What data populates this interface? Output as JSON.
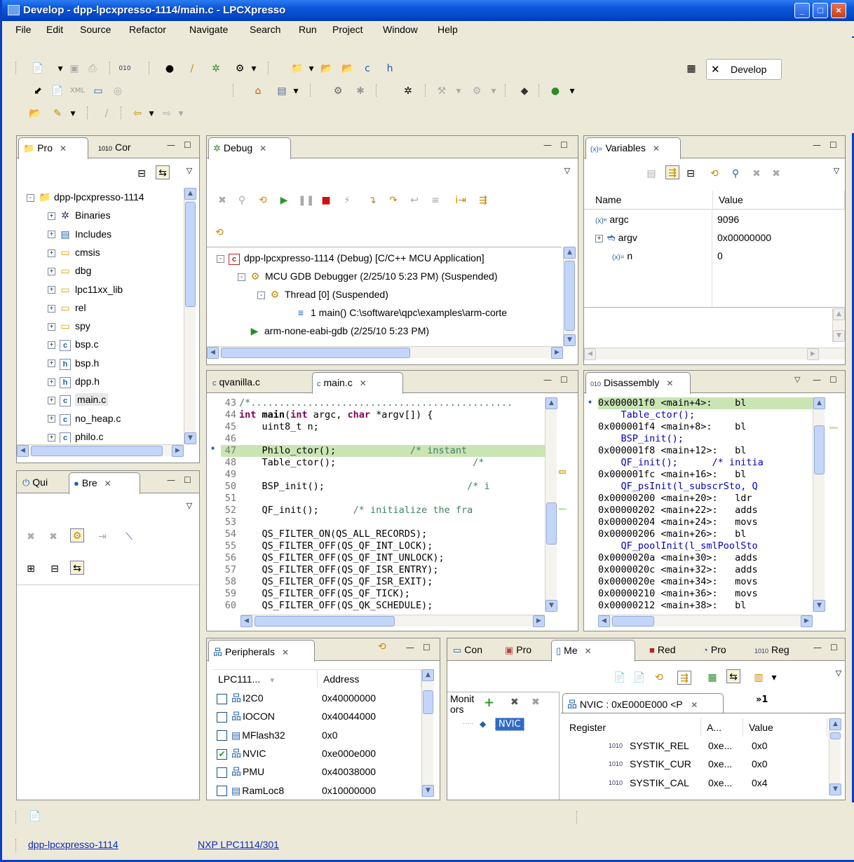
{
  "window": {
    "title": "Develop - dpp-lpcxpresso-1114/main.c - LPCXpresso"
  },
  "menu": [
    "File",
    "Edit",
    "Source",
    "Refactor",
    "Navigate",
    "Search",
    "Run",
    "Project",
    "Window",
    "Help"
  ],
  "perspective": {
    "label": "Develop"
  },
  "project_explorer": {
    "tabs": [
      "Pro",
      "Cor"
    ],
    "items": [
      {
        "label": "dpp-lpcxpresso-1114",
        "icon": "project-icon",
        "level": 0,
        "expand": "-"
      },
      {
        "label": "Binaries",
        "icon": "binaries-icon",
        "level": 1,
        "expand": "+"
      },
      {
        "label": "Includes",
        "icon": "includes-icon",
        "level": 1,
        "expand": "+"
      },
      {
        "label": "cmsis",
        "icon": "folder-icon",
        "level": 1,
        "expand": "+"
      },
      {
        "label": "dbg",
        "icon": "folder-icon",
        "level": 1,
        "expand": "+"
      },
      {
        "label": "lpc11xx_lib",
        "icon": "folder-icon",
        "level": 1,
        "expand": "+"
      },
      {
        "label": "rel",
        "icon": "folder-icon",
        "level": 1,
        "expand": "+"
      },
      {
        "label": "spy",
        "icon": "folder-icon",
        "level": 1,
        "expand": "+"
      },
      {
        "label": "bsp.c",
        "icon": "c-file-icon",
        "level": 1,
        "expand": "+"
      },
      {
        "label": "bsp.h",
        "icon": "h-file-icon",
        "level": 1,
        "expand": "+"
      },
      {
        "label": "dpp.h",
        "icon": "h-file-icon",
        "level": 1,
        "expand": "+"
      },
      {
        "label": "main.c",
        "icon": "c-file-icon",
        "level": 1,
        "expand": "+",
        "selected": true
      },
      {
        "label": "no_heap.c",
        "icon": "c-file-icon",
        "level": 1,
        "expand": "+"
      },
      {
        "label": "philo.c",
        "icon": "c-file-icon",
        "level": 1,
        "expand": "+"
      }
    ]
  },
  "breakpoints": {
    "tabs": [
      "Qui",
      "Bre"
    ]
  },
  "debug": {
    "tab": "Debug",
    "items": [
      {
        "label": "dpp-lpcxpresso-1114 (Debug) [C/C++ MCU Application]",
        "level": 0
      },
      {
        "label": "MCU GDB Debugger (2/25/10 5:23 PM) (Suspended)",
        "level": 1
      },
      {
        "label": "Thread [0] (Suspended)",
        "level": 2
      },
      {
        "label": "1 main() C:\\software\\qpc\\examples\\arm-corte",
        "level": 3
      },
      {
        "label": "arm-none-eabi-gdb (2/25/10 5:23 PM)",
        "level": 1
      }
    ]
  },
  "variables": {
    "tab": "Variables",
    "columns": [
      "Name",
      "Value"
    ],
    "rows": [
      {
        "name": "argc",
        "value": "9096"
      },
      {
        "name": "argv",
        "value": "0x00000000"
      },
      {
        "name": "n",
        "value": "0"
      }
    ]
  },
  "editor": {
    "tabs": [
      "qvanilla.c",
      "main.c"
    ],
    "lines": [
      {
        "n": "43",
        "t": "/*.............................................."
      },
      {
        "n": "44",
        "t": "int main(int argc, char *argv[]) {"
      },
      {
        "n": "45",
        "t": "    uint8_t n;"
      },
      {
        "n": "46",
        "t": ""
      },
      {
        "n": "47",
        "t": "    Philo_ctor();             /* instant"
      },
      {
        "n": "48",
        "t": "    Table_ctor();                        /*"
      },
      {
        "n": "49",
        "t": ""
      },
      {
        "n": "50",
        "t": "    BSP_init();                         /* i"
      },
      {
        "n": "51",
        "t": ""
      },
      {
        "n": "52",
        "t": "    QF_init();      /* initialize the fra"
      },
      {
        "n": "53",
        "t": ""
      },
      {
        "n": "54",
        "t": "    QS_FILTER_ON(QS_ALL_RECORDS);"
      },
      {
        "n": "55",
        "t": "    QS_FILTER_OFF(QS_QF_INT_LOCK);"
      },
      {
        "n": "56",
        "t": "    QS_FILTER_OFF(QS_QF_INT_UNLOCK);"
      },
      {
        "n": "57",
        "t": "    QS_FILTER_OFF(QS_QF_ISR_ENTRY);"
      },
      {
        "n": "58",
        "t": "    QS_FILTER_OFF(QS_QF_ISR_EXIT);"
      },
      {
        "n": "59",
        "t": "    QS_FILTER_OFF(QS_QF_TICK);"
      },
      {
        "n": "60",
        "t": "    QS_FILTER_OFF(QS_QK_SCHEDULE);"
      }
    ]
  },
  "disassembly": {
    "tab": "Disassembly",
    "lines": [
      {
        "t": "0x000001f0 <main+4>:    bl",
        "src": false,
        "current": true
      },
      {
        "t": "    Table_ctor();",
        "src": true
      },
      {
        "t": "0x000001f4 <main+8>:    bl",
        "src": false
      },
      {
        "t": "    BSP_init();",
        "src": true
      },
      {
        "t": "0x000001f8 <main+12>:   bl",
        "src": false
      },
      {
        "t": "    QF_init();      /* initia",
        "src": true
      },
      {
        "t": "0x000001fc <main+16>:   bl",
        "src": false
      },
      {
        "t": "    QF_psInit(l_subscrSto, Q",
        "src": true
      },
      {
        "t": "0x00000200 <main+20>:   ldr",
        "src": false
      },
      {
        "t": "0x00000202 <main+22>:   adds",
        "src": false
      },
      {
        "t": "0x00000204 <main+24>:   movs",
        "src": false
      },
      {
        "t": "0x00000206 <main+26>:   bl",
        "src": false
      },
      {
        "t": "    QF_poolInit(l_smlPoolSto",
        "src": true
      },
      {
        "t": "0x0000020a <main+30>:   adds",
        "src": false
      },
      {
        "t": "0x0000020c <main+32>:   adds",
        "src": false
      },
      {
        "t": "0x0000020e <main+34>:   movs",
        "src": false
      },
      {
        "t": "0x00000210 <main+36>:   movs",
        "src": false
      },
      {
        "t": "0x00000212 <main+38>:   bl",
        "src": false
      }
    ]
  },
  "peripherals": {
    "tab": "Peripherals",
    "columns": [
      "LPC111...",
      "Address"
    ],
    "rows": [
      {
        "name": "I2C0",
        "address": "0x40000000",
        "checked": false,
        "icon": "peripheral-icon"
      },
      {
        "name": "IOCON",
        "address": "0x40044000",
        "checked": false,
        "icon": "peripheral-icon"
      },
      {
        "name": "MFlash32",
        "address": "0x0",
        "checked": false,
        "icon": "memory-icon"
      },
      {
        "name": "NVIC",
        "address": "0xe000e000",
        "checked": true,
        "icon": "peripheral-icon"
      },
      {
        "name": "PMU",
        "address": "0x40038000",
        "checked": false,
        "icon": "peripheral-icon"
      },
      {
        "name": "RamLoc8",
        "address": "0x10000000",
        "checked": false,
        "icon": "memory-icon"
      }
    ]
  },
  "memory": {
    "tabs": [
      "Con",
      "Pro",
      "Me",
      "Red",
      "Pro",
      "Reg"
    ],
    "monitors_label": "Monit ors",
    "monitor_item": "NVIC",
    "rendering_tab": "NVIC : 0xE000E000 <P",
    "overflow": "»1",
    "columns": [
      "Register",
      "A...",
      "Value"
    ],
    "rows": [
      {
        "reg": "SYSTIK_REL",
        "addr": "0xe...",
        "value": "0x0"
      },
      {
        "reg": "SYSTIK_CUR",
        "addr": "0xe...",
        "value": "0x0"
      },
      {
        "reg": "SYSTIK_CAL",
        "addr": "0xe...",
        "value": "0x4"
      }
    ]
  },
  "status": {
    "project": "dpp-lpcxpresso-1114",
    "target": "NXP LPC1114/301"
  }
}
